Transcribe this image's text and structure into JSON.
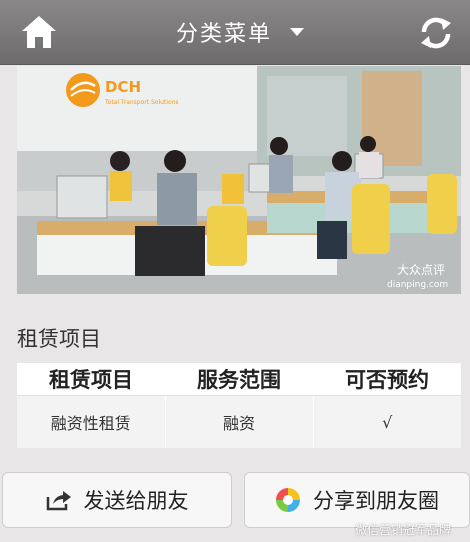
{
  "header": {
    "title": "分类菜单",
    "home_icon": "home-icon",
    "refresh_icon": "refresh-icon",
    "dropdown_icon": "caret-down-icon"
  },
  "photo": {
    "logo_text": "DCH",
    "logo_subtitle": "Total Transport Solutions",
    "watermark_cn": "大众点评",
    "watermark_en": "dianping.com"
  },
  "section": {
    "title": "租赁项目"
  },
  "table": {
    "headers": [
      "租赁项目",
      "服务范围",
      "可否预约"
    ],
    "rows": [
      [
        "融资性租赁",
        "融资",
        "√"
      ]
    ]
  },
  "actions": {
    "send_label": "发送给朋友",
    "share_label": "分享到朋友圈"
  },
  "footer": {
    "watermark": "微信营销冠军品牌"
  },
  "colors": {
    "header_bg": "#7b7979",
    "page_bg": "#e8e6e6",
    "logo_orange": "#f39a1d"
  }
}
